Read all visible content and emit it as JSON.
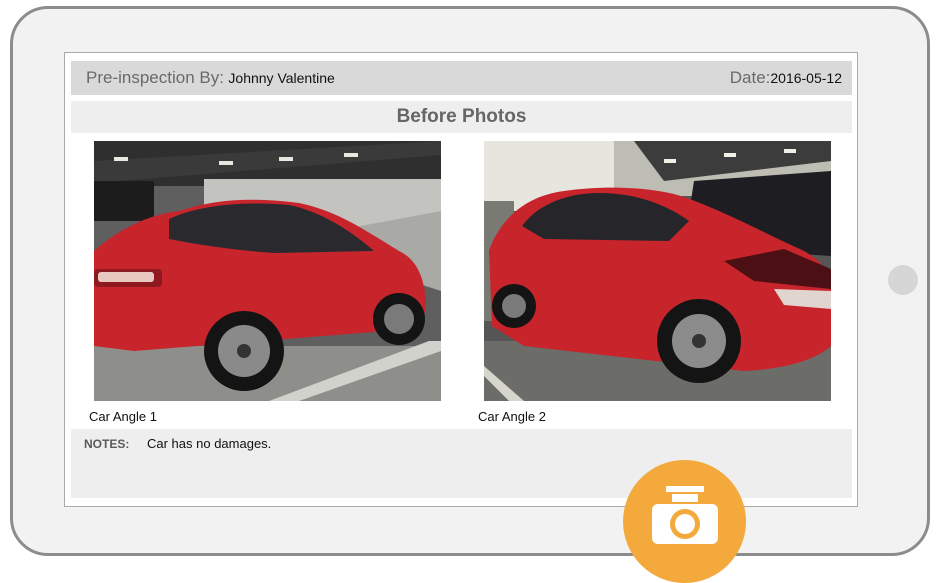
{
  "report": {
    "inspector_label": "Pre-inspection By:",
    "inspector_name": "Johnny Valentine",
    "date_label": "Date:",
    "date_value": "2016-05-12",
    "section_title": "Before Photos"
  },
  "photos": [
    {
      "caption": "Car Angle 1",
      "subject": "red-sedan-rear-quarter"
    },
    {
      "caption": "Car Angle 2",
      "subject": "red-sedan-front-quarter"
    }
  ],
  "notes": {
    "label": "NOTES:",
    "text": "Car has no damages."
  },
  "actions": {
    "camera_icon": "camera-icon"
  },
  "colors": {
    "header_bar": "#d9d9d9",
    "panel": "#eeeeee",
    "accent": "#f4a93c",
    "car": "#c8242c"
  }
}
